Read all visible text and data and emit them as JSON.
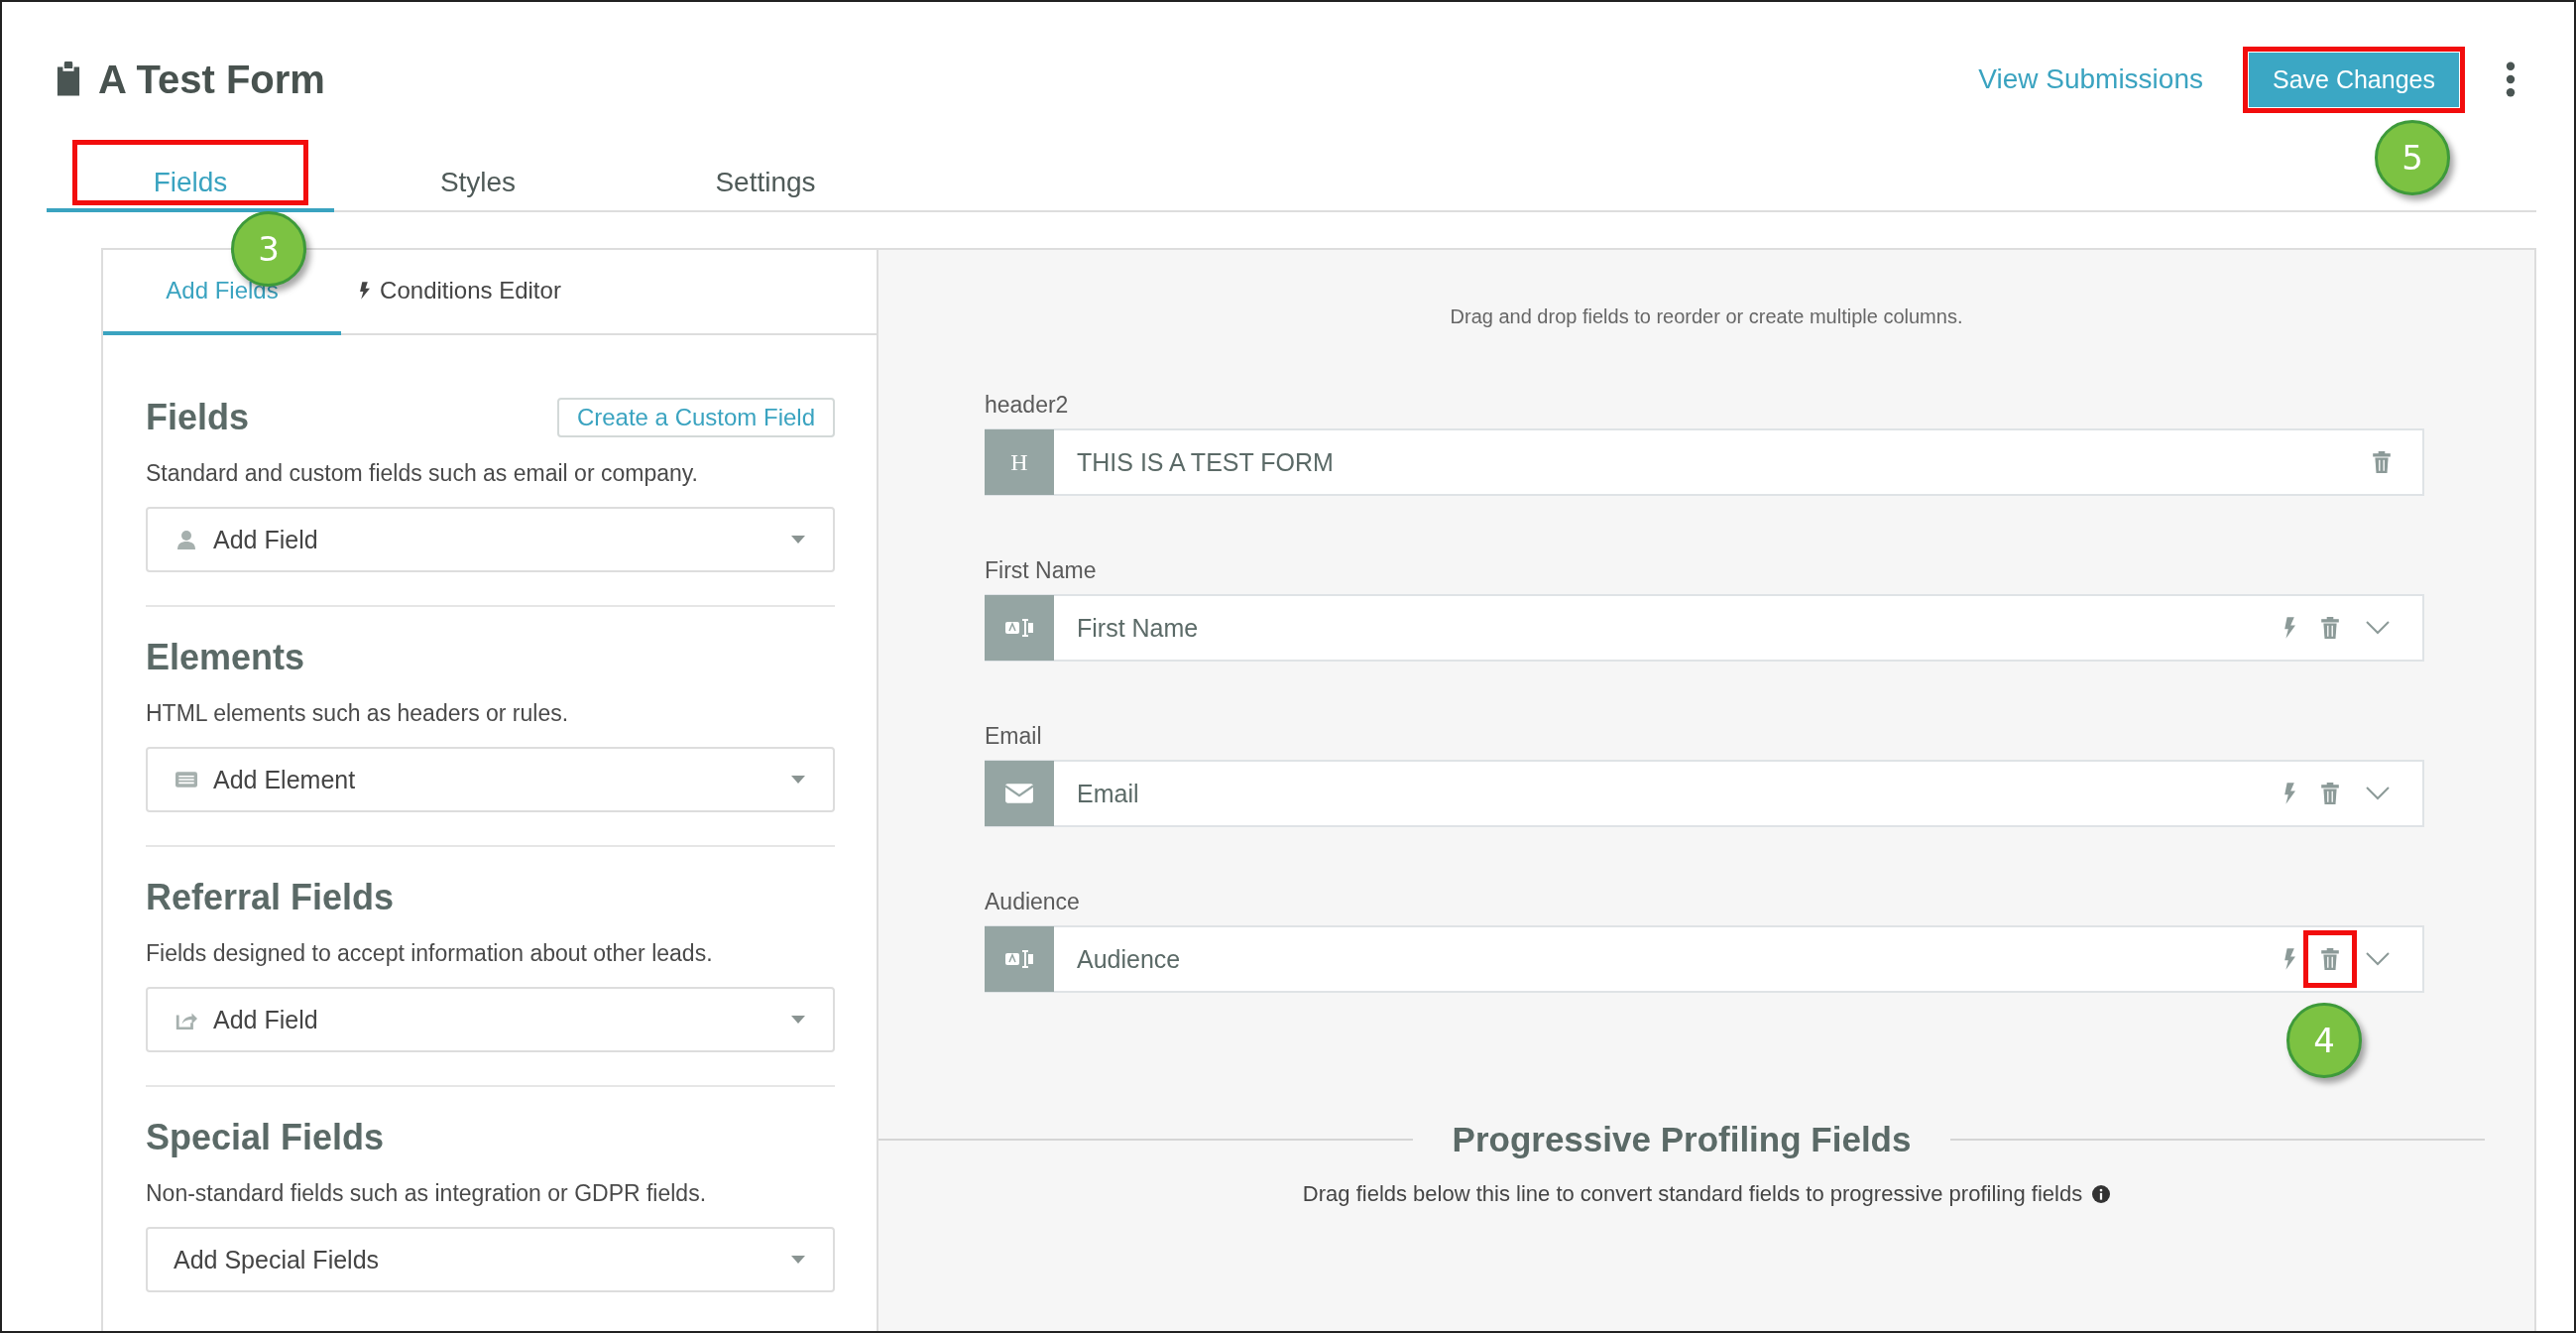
{
  "header": {
    "title": "A Test Form",
    "view_link": "View Submissions",
    "save_button": {
      "label": "Save Changes",
      "highlighted": true,
      "callout": "5"
    }
  },
  "tabs": [
    {
      "label": "Fields",
      "selected": true,
      "highlighted": true,
      "callout": "3"
    },
    {
      "label": "Styles",
      "selected": false,
      "highlighted": false
    },
    {
      "label": "Settings",
      "selected": false,
      "highlighted": false
    }
  ],
  "sub_tabs": [
    {
      "label": "Add Fields",
      "selected": true,
      "kind": "plain"
    },
    {
      "label": "Conditions Editor",
      "selected": false,
      "kind": "bolt"
    }
  ],
  "sections": [
    {
      "title": "Fields",
      "action": "Create a Custom Field",
      "description": "Standard and custom fields such as email or company.",
      "dropdown": {
        "label": "Add Field",
        "kind": "person"
      }
    },
    {
      "title": "Elements",
      "description": "HTML elements such as headers or rules.",
      "dropdown": {
        "label": "Add Element",
        "kind": "element"
      }
    },
    {
      "title": "Referral Fields",
      "description": "Fields designed to accept information about other leads.",
      "dropdown": {
        "label": "Add Field",
        "kind": "share"
      }
    },
    {
      "title": "Special Fields",
      "description": "Non-standard fields such as integration or GDPR fields.",
      "dropdown": {
        "label": "Add Special Fields",
        "kind": "none"
      }
    }
  ],
  "canvas": {
    "hint": "Drag and drop fields to reorder or create multiple columns.",
    "fields": [
      {
        "label": "header2",
        "value": "THIS IS A TEST FORM",
        "kind": "header",
        "icon_text": "H",
        "delete_highlighted": false
      },
      {
        "label": "First Name",
        "value": "First Name",
        "kind": "text",
        "delete_highlighted": false
      },
      {
        "label": "Email",
        "value": "Email",
        "kind": "email",
        "delete_highlighted": false
      },
      {
        "label": "Audience",
        "value": "Audience",
        "kind": "text",
        "delete_highlighted": true,
        "callout": "4"
      }
    ],
    "progressive": {
      "title": "Progressive Profiling Fields",
      "description": "Drag fields below this line to convert standard fields to progressive profiling fields"
    }
  }
}
